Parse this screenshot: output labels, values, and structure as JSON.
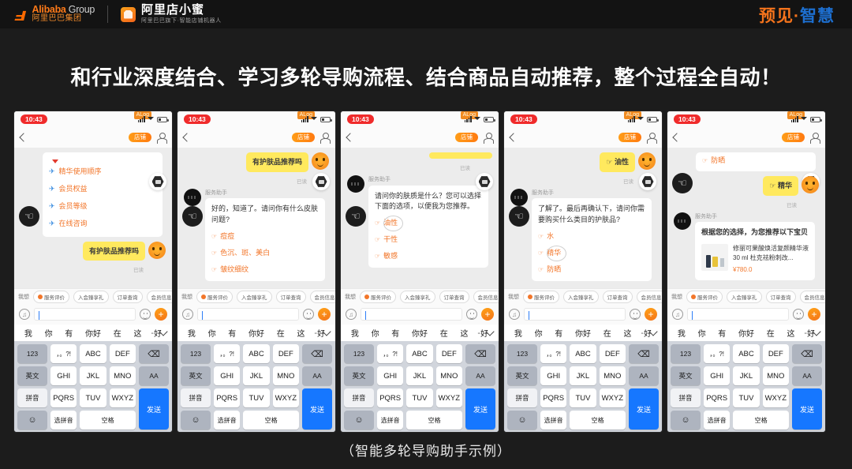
{
  "header": {
    "alibaba_en": "Alibaba",
    "alibaba_group": "Group",
    "alibaba_cn": "阿里巴巴集团",
    "product_cn": "阿里店小蜜",
    "product_sub": "阿里巴巴旗下·智能店铺机器人",
    "right_brand_orange": "预见",
    "right_brand_dot": "·",
    "right_brand_blue": "智慧"
  },
  "title": "和行业深度结合、学习多轮导购流程、结合商品自动推荐，整个过程全自动！",
  "caption": "（智能多轮导购助手示例）",
  "colors": {
    "accent_orange": "#f2762a",
    "user_bubble": "#ffe95e",
    "send_blue": "#1677ff",
    "brand_blue": "#1d6fd0",
    "clock_red": "#f02b2b"
  },
  "phone_common": {
    "clock": "10:43",
    "alog_badge": "ALog",
    "nav_pill": "店铺",
    "bot_name": "服务助手",
    "read_receipt": "已读",
    "chips_label": "我想",
    "chips": [
      "服务评价",
      "入会臻享礼",
      "订单查询",
      "会员信息"
    ],
    "input_placeholder": "",
    "keyboard": {
      "suggestions": [
        "我",
        "你",
        "有",
        "你好",
        "在",
        "这",
        "好"
      ],
      "divider": "-",
      "rows": [
        [
          "123",
          "，。?!",
          "ABC",
          "DEF",
          "⌫"
        ],
        [
          "英文",
          "GHI",
          "JKL",
          "MNO",
          "AA"
        ],
        [
          "拼音",
          "PQRS",
          "TUV",
          "WXYZ",
          "发送"
        ],
        [
          "☺",
          "选拼音",
          "空格"
        ]
      ],
      "send_label": "发送",
      "space_label": "空格",
      "pinyin_label": "选拼音",
      "emoji_label": "☺"
    }
  },
  "phones": [
    {
      "id": "phone-1",
      "menu_items": [
        "精华使用顺序",
        "会员权益",
        "会员等级",
        "在线咨询"
      ],
      "user_message": "有护肤品推荐吗",
      "show_read": true
    },
    {
      "id": "phone-2",
      "user_message": "有护肤品推荐吗",
      "show_read": true,
      "bot_text": "好的，知道了。请问你有什么皮肤问题?",
      "options": [
        "痘痘",
        "色沉、斑、美白",
        "皱纹细纹"
      ],
      "circled_index": -1
    },
    {
      "id": "phone-3",
      "show_read": true,
      "bot_text": "请问你的肤质是什么？您可以选择下面的选项，以便我为您推荐。",
      "options": [
        "油性",
        "干性",
        "敏感"
      ],
      "circled_index": 0
    },
    {
      "id": "phone-4",
      "user_message": "油性",
      "user_has_hand": true,
      "show_read": true,
      "bot_text": "了解了。最后再确认下，请问你需要购买什么类目的护肤品?",
      "options": [
        "水",
        "精华",
        "防晒"
      ],
      "circled_index": 1
    },
    {
      "id": "phone-5",
      "prev_option": "防晒",
      "user_message": "精华",
      "user_has_hand": true,
      "show_read": true,
      "bot_text": "根据您的选择，为您推荐以下宝贝",
      "product": {
        "title": "修丽可果酸焕活复颜精华液 30 ml 杜克祛粉刺改...",
        "price": "¥780.0"
      }
    }
  ]
}
